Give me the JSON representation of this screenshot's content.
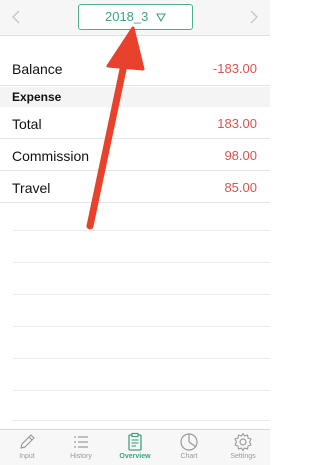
{
  "header": {
    "period_label": "2018_3",
    "period_dropdown_icon": "triangle-down-icon",
    "prev_icon": "chevron-left-icon",
    "next_icon": "chevron-right-icon"
  },
  "balance": {
    "label": "Balance",
    "value": "-183.00"
  },
  "expense": {
    "section_label": "Expense",
    "rows": [
      {
        "label": "Total",
        "value": "183.00"
      },
      {
        "label": "Commission",
        "value": "98.00"
      },
      {
        "label": "Travel",
        "value": "85.00"
      }
    ]
  },
  "annotation": {
    "icon": "red-arrow-pointer",
    "color": "#e8412c"
  },
  "colors": {
    "accent": "#3fa37f",
    "negative": "#d9534f",
    "inactive": "#9a9a9a"
  },
  "tabbar": {
    "tabs": [
      {
        "label": "Input",
        "icon": "pencil-icon",
        "active": false
      },
      {
        "label": "History",
        "icon": "list-icon",
        "active": false
      },
      {
        "label": "Overview",
        "icon": "clipboard-icon",
        "active": true
      },
      {
        "label": "Chart",
        "icon": "pie-chart-icon",
        "active": false
      },
      {
        "label": "Settings",
        "icon": "gear-icon",
        "active": false
      }
    ]
  }
}
